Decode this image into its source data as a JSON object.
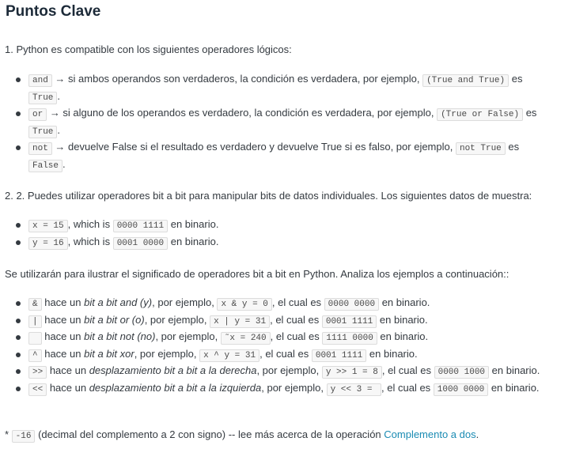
{
  "title": "Puntos Clave",
  "point1": "1. Python es compatible con los siguientes operadores lógicos:",
  "logic": [
    {
      "op": "and",
      "t1": " → si ambos operandos son verdaderos, la condición es verdadera, por ejemplo, ",
      "ex": "(True and True)",
      "t2": " es",
      "res": "True",
      "t3": "."
    },
    {
      "op": "or",
      "t1": " → si alguno de los operandos es verdadero, la condición es verdadera, por ejemplo, ",
      "ex": "(True or False)",
      "t2": " es",
      "res": "True",
      "t3": "."
    },
    {
      "op": "not",
      "t1": " → devuelve False si el resultado es verdadero y devuelve True si es falso, por ejemplo, ",
      "ex": "not True",
      "t2": " es",
      "res": "False",
      "t3": "."
    }
  ],
  "point2": "2. 2. Puedes utilizar operadores bit a bit para manipular bits de datos individuales. Los siguientes datos de muestra:",
  "samples": [
    {
      "code": "x = 15",
      "t1": ", which is ",
      "bin": "0000 1111",
      "t2": " en binario."
    },
    {
      "code": "y = 16",
      "t1": ", which is ",
      "bin": "0001 0000",
      "t2": " en binario."
    }
  ],
  "intro": "Se utilizarán para ilustrar el significado de operadores bit a bit en Python. Analiza los ejemplos a continuación::",
  "bitwise": [
    {
      "op": "&",
      "t1": " hace un ",
      "name": "bit a bit and (y)",
      "t2": ", por ejemplo, ",
      "ex": "x & y = 0",
      "t3": ", el cual es ",
      "bin": "0000 0000",
      "t4": " en binario."
    },
    {
      "op": "|",
      "t1": " hace un ",
      "name": "bit a bit or (o)",
      "t2": ", por ejemplo, ",
      "ex": "x | y = 31",
      "t3": ", el cual es ",
      "bin": "0001 1111",
      "t4": " en binario."
    },
    {
      "op": " ",
      "t1": " hace un ",
      "name": "bit a bit not (no)",
      "t2": ", por ejemplo, ",
      "ex": "˜x = 240",
      "t3": ", el cual es ",
      "bin": "1111 0000",
      "t4": " en binario."
    },
    {
      "op": "^",
      "t1": " hace un ",
      "name": "bit a bit xor",
      "t2": ", por ejemplo, ",
      "ex": "x ^ y = 31",
      "t3": ", el cual es ",
      "bin": "0001 1111",
      "t4": " en binario."
    },
    {
      "op": ">>",
      "t1": " hace un ",
      "name": "desplazamiento bit a bit a la derecha",
      "t2": ", por ejemplo, ",
      "ex": "y >> 1 = 8",
      "t3": ", el cual es ",
      "bin": "0000 1000",
      "t4": " en binario."
    },
    {
      "op": "<<",
      "t1": " hace un ",
      "name": "desplazamiento bit a bit a la izquierda",
      "t2": ", por ejemplo, ",
      "ex": "y << 3 = ",
      "t3": ", el cual es ",
      "bin": "1000 0000",
      "t4": " en binario."
    }
  ],
  "footnote": {
    "star": "* ",
    "code": "-16",
    "text": " (decimal del complemento a 2 con signo) -- lee más acerca de la operación ",
    "link": "Complemento a dos",
    "end": "."
  },
  "colors": {
    "link": "#1a8bb3",
    "text": "#343a40",
    "title": "#1c2a38"
  }
}
